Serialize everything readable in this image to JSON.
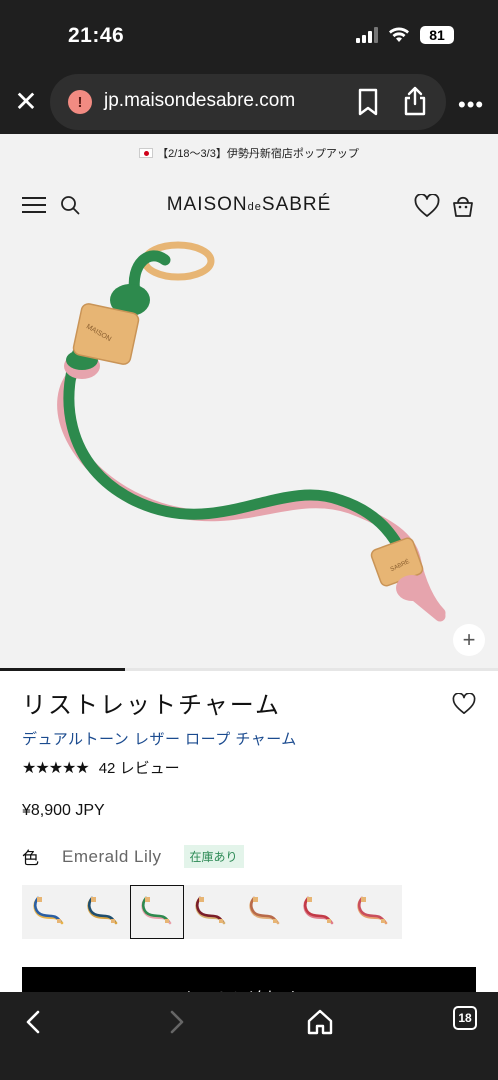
{
  "status_bar": {
    "time": "21:46",
    "battery": "81"
  },
  "browser": {
    "url": "jp.maisondesabre.com",
    "tab_count": "18"
  },
  "promo": {
    "text": "【2/18〜3/3】伊勢丹新宿店ポップアップ"
  },
  "header": {
    "logo_main_1": "MAISON",
    "logo_de": "de",
    "logo_main_2": "SABRÉ"
  },
  "product": {
    "title": "リストレットチャーム",
    "subtitle": "デュアルトーン レザー ロープ チャーム",
    "stars": "★★★★★",
    "reviews": "42 レビュー",
    "price": "¥8,900 JPY",
    "color_label": "色",
    "color_name": "Emerald Lily",
    "stock": "在庫あり",
    "add_to_cart": "カートに追加する",
    "image_charm_text_1": "MAISON",
    "image_charm_text_2": "SABRÉ"
  },
  "gallery": {
    "progress": 0.25
  },
  "swatches": [
    {
      "c1": "#2b5fa3",
      "c2": "#e8b34a",
      "selected": false
    },
    {
      "c1": "#1f4e6e",
      "c2": "#d9a441",
      "selected": false
    },
    {
      "c1": "#2f8a4f",
      "c2": "#e9a0ab",
      "selected": true
    },
    {
      "c1": "#7a1e2a",
      "c2": "#d6b070",
      "selected": false
    },
    {
      "c1": "#b86a4a",
      "c2": "#e3b07a",
      "selected": false
    },
    {
      "c1": "#c23a47",
      "c2": "#e07e8c",
      "selected": false
    },
    {
      "c1": "#c94f5e",
      "c2": "#e8a06e",
      "selected": false
    }
  ],
  "colors": {
    "leather_green": "#2d8a4d",
    "leather_pink": "#e6a4ad",
    "gold": "#e7b574",
    "link_blue": "#1b4b8f"
  }
}
